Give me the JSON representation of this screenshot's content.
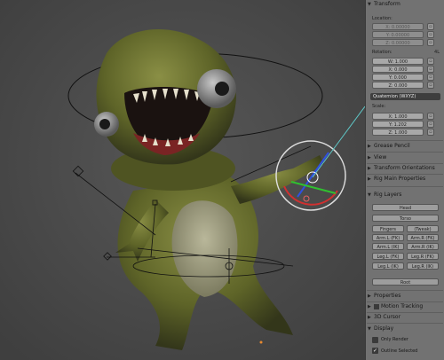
{
  "properties_panel": {
    "transform": {
      "header": "Transform",
      "location_label": "Location:",
      "location": [
        "X: 0.00000",
        "Y: 0.00000",
        "Z: 0.00000"
      ],
      "rotation_label": "Rotation:",
      "rotation_extra": "4L",
      "rotation": [
        "W: 1.000",
        "X: 0.000",
        "Y: 0.000",
        "Z: 0.000"
      ],
      "rotation_mode": "Quaternion (WXYZ)",
      "scale_label": "Scale:",
      "scale": [
        "X: 1.000",
        "Y: 1.202",
        "Z: 1.000"
      ]
    },
    "collapsed_sections": [
      "Grease Pencil",
      "View",
      "Transform Orientations",
      "Rig Main Properties"
    ],
    "rig_layers": {
      "header": "Rig Layers",
      "head": "Head",
      "torso": "Torso",
      "fingers": "Fingers",
      "tweak": "(Tweak)",
      "arm_l_fk": "Arm.L (FK)",
      "arm_r_fk": "Arm.R (FK)",
      "arm_l_ik": "Arm.L (IK)",
      "arm_r_ik": "Arm.R (IK)",
      "leg_l_fk": "Leg.L (FK)",
      "leg_r_fk": "Leg.R (FK)",
      "leg_l_ik": "Leg.L (IK)",
      "leg_r_ik": "Leg.R (IK)",
      "root": "Root"
    },
    "properties": "Properties",
    "motion_tracking": "Motion Tracking",
    "cursor_3d": "3D Cursor",
    "display": {
      "header": "Display",
      "only_render": "Only Render",
      "outline_selected": "Outline Selected"
    }
  },
  "colors": {
    "panel_bg": "#727272",
    "viewport_bg": "#4d4d4d",
    "field_bg": "#a8a8a8",
    "gizmo_x": "#d03030",
    "gizmo_y": "#30c030",
    "gizmo_z": "#3050e0"
  }
}
